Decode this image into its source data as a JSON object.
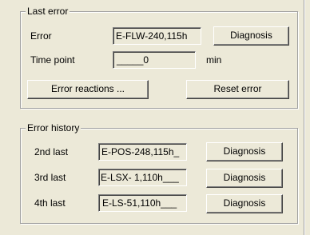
{
  "last_error": {
    "title": "Last error",
    "error_label": "Error",
    "error_value": "E-FLW-240,115h",
    "diagnosis_label": "Diagnosis",
    "time_point_label": "Time point",
    "time_point_value": "_____0",
    "time_unit": "min",
    "error_reactions_label": "Error reactions ...",
    "reset_error_label": "Reset error"
  },
  "error_history": {
    "title": "Error history",
    "rows": [
      {
        "label": "2nd last",
        "value": "E-POS-248,115h_",
        "button": "Diagnosis"
      },
      {
        "label": "3rd last",
        "value": "E-LSX- 1,110h___",
        "button": "Diagnosis"
      },
      {
        "label": "4th last",
        "value": "E-LS-51,110h___",
        "button": "Diagnosis"
      }
    ]
  }
}
